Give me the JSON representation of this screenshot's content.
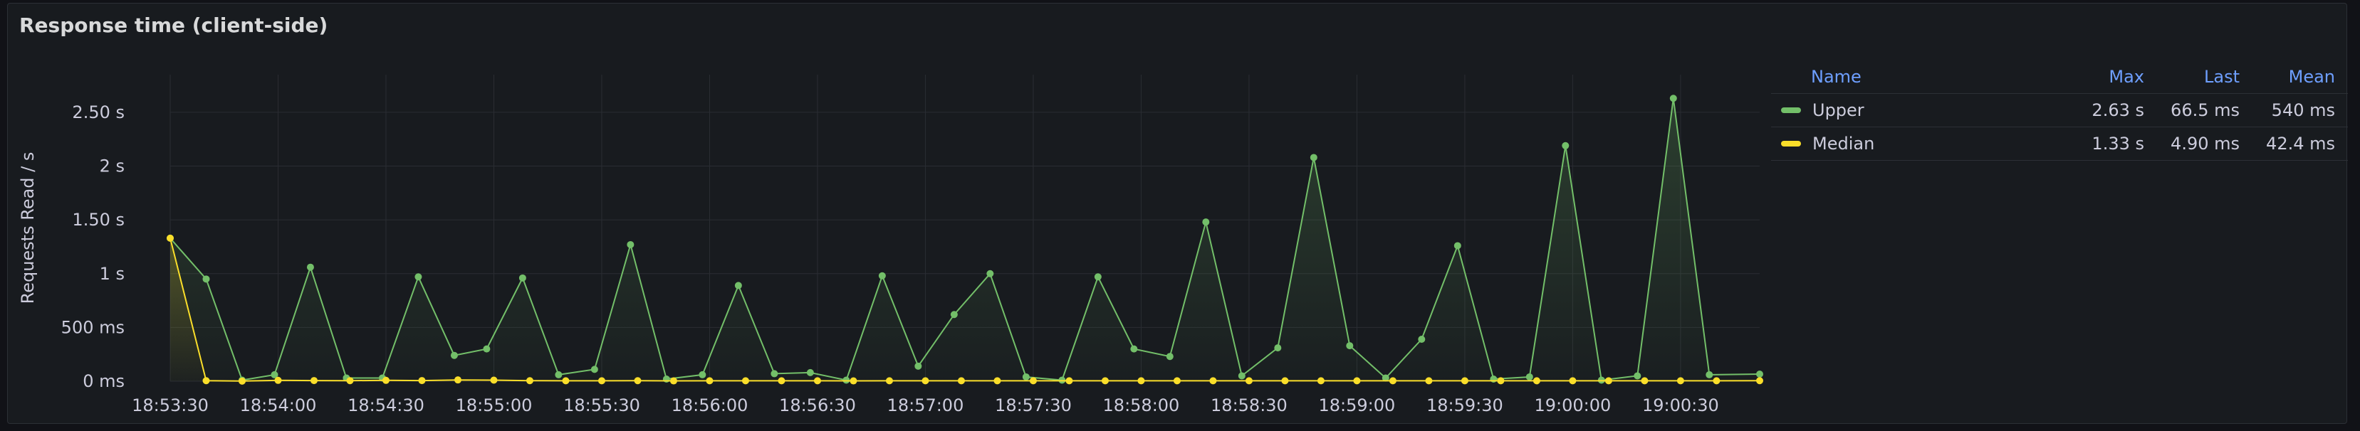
{
  "panel": {
    "title": "Response time (client-side)"
  },
  "legend": {
    "headers": {
      "name": "Name",
      "max": "Max",
      "last": "Last",
      "mean": "Mean"
    },
    "rows": [
      {
        "name": "Upper",
        "max": "2.63 s",
        "last": "66.5 ms",
        "mean": "540 ms",
        "color": "#73bf69"
      },
      {
        "name": "Median",
        "max": "1.33 s",
        "last": "4.90 ms",
        "mean": "42.4 ms",
        "color": "#fade2a"
      }
    ]
  },
  "chart_data": {
    "type": "line",
    "title": "Response time (client-side)",
    "ylabel": "Requests Read / s",
    "xlabel": "",
    "ylim": [
      0,
      2.85
    ],
    "y_unit": "s",
    "y_ticks": [
      {
        "value": 0,
        "label": "0 ms"
      },
      {
        "value": 0.5,
        "label": "500 ms"
      },
      {
        "value": 1,
        "label": "1 s"
      },
      {
        "value": 1.5,
        "label": "1.50 s"
      },
      {
        "value": 2,
        "label": "2 s"
      },
      {
        "value": 2.5,
        "label": "2.50 s"
      }
    ],
    "x_ticks": [
      "18:53:30",
      "18:54:00",
      "18:54:30",
      "18:55:00",
      "18:55:30",
      "18:56:00",
      "18:56:30",
      "18:57:00",
      "18:57:30",
      "18:58:00",
      "18:58:30",
      "18:59:00",
      "18:59:30",
      "19:00:00",
      "19:00:30"
    ],
    "x_start": "18:53:30",
    "x_end": "19:00:52",
    "grid": true,
    "legend_position": "right",
    "series": [
      {
        "name": "Upper",
        "color": "#73bf69",
        "points": [
          [
            "18:53:30",
            1.33
          ],
          [
            "18:53:40",
            0.95
          ],
          [
            "18:53:50",
            0.01
          ],
          [
            "18:53:59",
            0.06
          ],
          [
            "18:54:09",
            1.06
          ],
          [
            "18:54:19",
            0.03
          ],
          [
            "18:54:29",
            0.03
          ],
          [
            "18:54:39",
            0.97
          ],
          [
            "18:54:49",
            0.24
          ],
          [
            "18:54:58",
            0.3
          ],
          [
            "18:55:08",
            0.96
          ],
          [
            "18:55:18",
            0.06
          ],
          [
            "18:55:28",
            0.11
          ],
          [
            "18:55:38",
            1.27
          ],
          [
            "18:55:48",
            0.02
          ],
          [
            "18:55:58",
            0.06
          ],
          [
            "18:56:08",
            0.89
          ],
          [
            "18:56:18",
            0.07
          ],
          [
            "18:56:28",
            0.08
          ],
          [
            "18:56:38",
            0.01
          ],
          [
            "18:56:48",
            0.98
          ],
          [
            "18:56:58",
            0.14
          ],
          [
            "18:57:08",
            0.62
          ],
          [
            "18:57:18",
            1.0
          ],
          [
            "18:57:28",
            0.04
          ],
          [
            "18:57:38",
            0.01
          ],
          [
            "18:57:48",
            0.97
          ],
          [
            "18:57:58",
            0.3
          ],
          [
            "18:58:08",
            0.23
          ],
          [
            "18:58:18",
            1.48
          ],
          [
            "18:58:28",
            0.05
          ],
          [
            "18:58:38",
            0.31
          ],
          [
            "18:58:48",
            2.08
          ],
          [
            "18:58:58",
            0.33
          ],
          [
            "18:59:08",
            0.03
          ],
          [
            "18:59:18",
            0.39
          ],
          [
            "18:59:28",
            1.26
          ],
          [
            "18:59:38",
            0.02
          ],
          [
            "18:59:48",
            0.04
          ],
          [
            "18:59:58",
            2.19
          ],
          [
            "19:00:08",
            0.01
          ],
          [
            "19:00:18",
            0.05
          ],
          [
            "19:00:28",
            2.63
          ],
          [
            "19:00:38",
            0.06
          ],
          [
            "19:00:52",
            0.066
          ]
        ]
      },
      {
        "name": "Median",
        "color": "#fade2a",
        "points": [
          [
            "18:53:30",
            1.33
          ],
          [
            "18:53:40",
            0.005
          ],
          [
            "18:53:50",
            0.001
          ],
          [
            "18:54:00",
            0.008
          ],
          [
            "18:54:10",
            0.006
          ],
          [
            "18:54:20",
            0.005
          ],
          [
            "18:54:30",
            0.008
          ],
          [
            "18:54:40",
            0.006
          ],
          [
            "18:54:50",
            0.012
          ],
          [
            "18:55:00",
            0.01
          ],
          [
            "18:55:10",
            0.005
          ],
          [
            "18:55:20",
            0.004
          ],
          [
            "18:55:30",
            0.004
          ],
          [
            "18:55:40",
            0.005
          ],
          [
            "18:55:50",
            0.003
          ],
          [
            "18:56:00",
            0.004
          ],
          [
            "18:56:10",
            0.004
          ],
          [
            "18:56:20",
            0.004
          ],
          [
            "18:56:30",
            0.004
          ],
          [
            "18:56:40",
            0.003
          ],
          [
            "18:56:50",
            0.004
          ],
          [
            "18:57:00",
            0.004
          ],
          [
            "18:57:10",
            0.004
          ],
          [
            "18:57:20",
            0.004
          ],
          [
            "18:57:30",
            0.004
          ],
          [
            "18:57:40",
            0.004
          ],
          [
            "18:57:50",
            0.004
          ],
          [
            "18:58:00",
            0.004
          ],
          [
            "18:58:10",
            0.004
          ],
          [
            "18:58:20",
            0.004
          ],
          [
            "18:58:30",
            0.004
          ],
          [
            "18:58:40",
            0.004
          ],
          [
            "18:58:50",
            0.004
          ],
          [
            "18:59:00",
            0.004
          ],
          [
            "18:59:10",
            0.004
          ],
          [
            "18:59:20",
            0.004
          ],
          [
            "18:59:30",
            0.004
          ],
          [
            "18:59:40",
            0.004
          ],
          [
            "18:59:50",
            0.004
          ],
          [
            "19:00:00",
            0.004
          ],
          [
            "19:00:10",
            0.004
          ],
          [
            "19:00:20",
            0.004
          ],
          [
            "19:00:30",
            0.004
          ],
          [
            "19:00:40",
            0.004
          ],
          [
            "19:00:52",
            0.0049
          ]
        ]
      }
    ]
  }
}
